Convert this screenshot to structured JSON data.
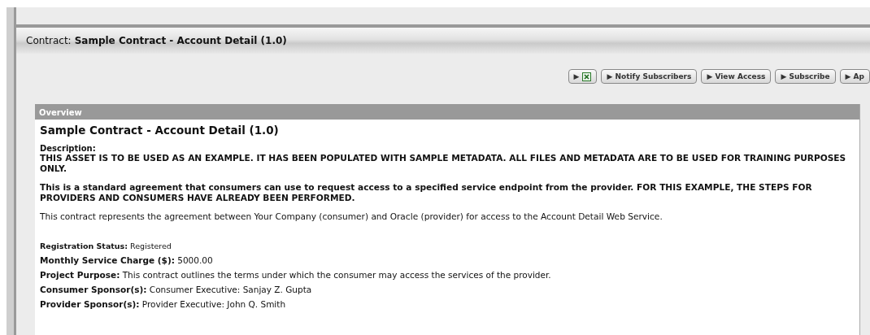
{
  "header": {
    "label": "Contract:",
    "title": "Sample Contract - Account Detail (1.0)"
  },
  "buttons": [
    {
      "kind": "excel",
      "label": "▶"
    },
    {
      "kind": "text",
      "label": "▶ Notify Subscribers"
    },
    {
      "kind": "text",
      "label": "▶ View Access"
    },
    {
      "kind": "text",
      "label": "▶ Subscribe"
    },
    {
      "kind": "text",
      "label": "▶ Ap"
    }
  ],
  "overview": {
    "heading": "Overview",
    "title": "Sample Contract - Account Detail (1.0)",
    "description_label": "Description:",
    "paragraphs": [
      {
        "kind": "bold",
        "text": "THIS ASSET IS TO BE USED AS AN EXAMPLE. IT HAS BEEN POPULATED WITH SAMPLE METADATA. ALL FILES AND METADATA ARE TO BE USED FOR TRAINING PURPOSES ONLY."
      },
      {
        "kind": "bold",
        "text": "This is a standard agreement that consumers can use to request access to a specified service endpoint from the provider. FOR THIS EXAMPLE, THE STEPS FOR PROVIDERS AND CONSUMERS HAVE ALREADY BEEN PERFORMED."
      },
      {
        "kind": "plain",
        "text": "This contract represents the agreement between Your Company (consumer) and Oracle (provider) for access to the Account Detail Web Service."
      }
    ],
    "fields": [
      {
        "kind": "small",
        "label": "Registration Status:",
        "value": "Registered"
      },
      {
        "kind": "normal",
        "label": "Monthly Service Charge ($):",
        "value": "5000.00"
      },
      {
        "kind": "normal",
        "label": "Project Purpose:",
        "value": "This contract outlines the terms under which the consumer may access the services of the provider."
      },
      {
        "kind": "normal",
        "label": "Consumer Sponsor(s):",
        "value": "Consumer Executive: Sanjay Z. Gupta"
      },
      {
        "kind": "normal",
        "label": "Provider Sponsor(s):",
        "value": "Provider Executive: John Q. Smith"
      }
    ]
  }
}
